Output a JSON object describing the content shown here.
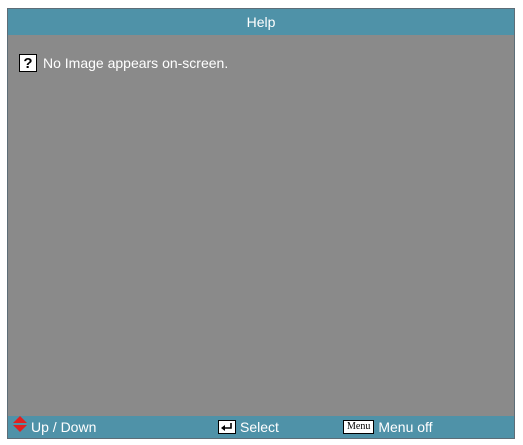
{
  "header": {
    "title": "Help"
  },
  "main": {
    "help_icon_glyph": "?",
    "message": "No Image appears on-screen."
  },
  "footer": {
    "updown_label": "Up / Down",
    "select_label": "Select",
    "menu_key_label": "Menu",
    "menuoff_label": "Menu off"
  },
  "colors": {
    "panel_bg": "#8a8a8a",
    "bar_bg": "#4f92a8",
    "updown_icon": "#e02020",
    "text": "#ffffff"
  },
  "icons": {
    "help": "question-icon",
    "updown": "up-down-arrows-icon",
    "select": "enter-key-icon",
    "menu": "menu-key-icon"
  }
}
